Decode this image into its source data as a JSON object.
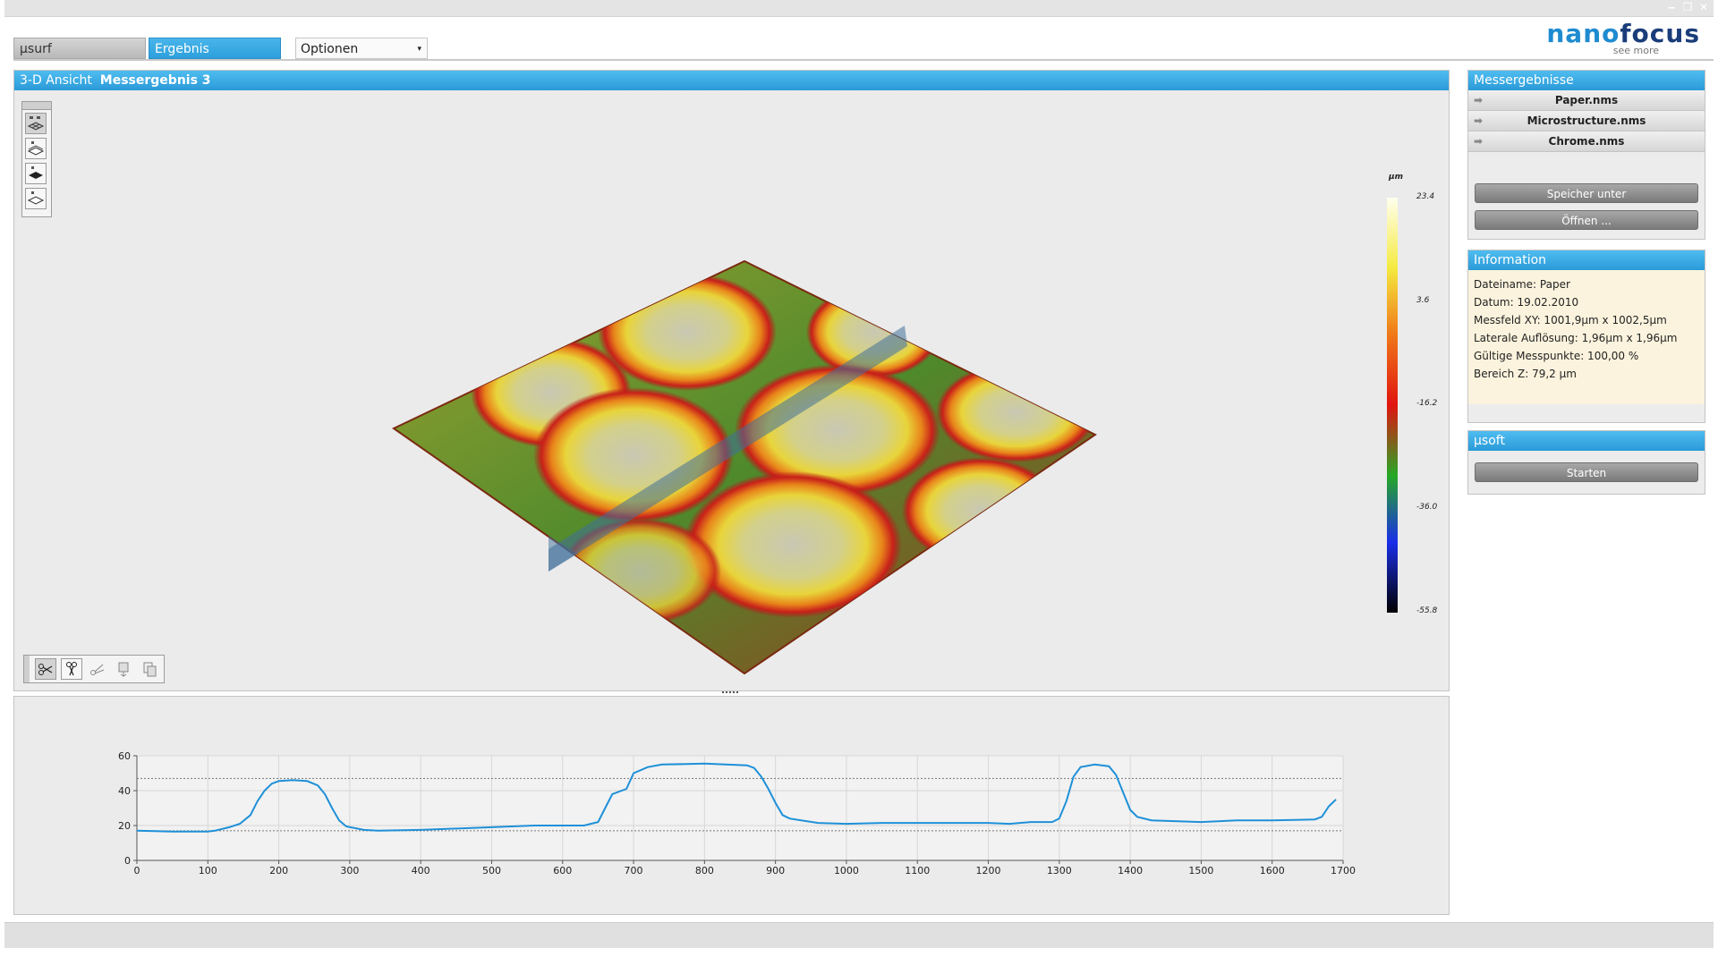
{
  "window": {
    "minimize_glyph": "‒",
    "restore_glyph": "❐",
    "close_glyph": "✕"
  },
  "tabs": [
    {
      "label": "µsurf"
    },
    {
      "label": "Ergebnis"
    }
  ],
  "options_dropdown": {
    "label": "Optionen",
    "arrow": "▾"
  },
  "logo": {
    "brand_part1": "nano",
    "brand_part2": "focus",
    "tagline": "see more"
  },
  "view3d": {
    "header_label": "3-D Ansicht",
    "header_title": "Messergebnis 3",
    "view_mode_icons": [
      "surface-mesh-icon",
      "surface-wireframe-icon",
      "surface-filled-icon",
      "surface-outline-icon"
    ],
    "tool_icons": [
      "cut-tool-icon",
      "cut-profile-icon",
      "cut-angle-icon",
      "export-icon",
      "copy-icon"
    ],
    "colorbar": {
      "unit": "µm",
      "ticks": [
        "23.4",
        "3.6",
        "-16.2",
        "-36.0",
        "-55.8"
      ],
      "colors": [
        "#ffffee",
        "#f5ea40",
        "#f07818",
        "#e01410",
        "#26a826",
        "#1a2ee8",
        "#000000"
      ]
    }
  },
  "chart_data": {
    "type": "line",
    "title": "",
    "xlabel": "",
    "ylabel": "",
    "xlim": [
      0,
      1700
    ],
    "ylim": [
      0,
      60
    ],
    "x_ticks": [
      "0",
      "100",
      "200",
      "300",
      "400",
      "500",
      "600",
      "700",
      "800",
      "900",
      "1000",
      "1100",
      "1200",
      "1300",
      "1400",
      "1500",
      "1600",
      "1700"
    ],
    "y_ticks": [
      "0",
      "20",
      "40",
      "60"
    ],
    "grid": true,
    "reference_lines": [
      47,
      17
    ],
    "line_color": "#1e90d8",
    "series": [
      {
        "x": [
          0,
          50,
          100,
          110,
          130,
          145,
          160,
          170,
          180,
          190,
          200,
          220,
          240,
          255,
          265,
          275,
          285,
          295,
          320,
          340,
          400,
          500,
          560,
          630,
          650,
          660,
          670,
          690,
          700,
          720,
          740,
          800,
          830,
          860,
          870,
          880,
          890,
          900,
          910,
          920,
          960,
          1000,
          1050,
          1100,
          1200,
          1230,
          1260,
          1290,
          1300,
          1310,
          1320,
          1330,
          1350,
          1370,
          1380,
          1390,
          1400,
          1410,
          1430,
          1500,
          1550,
          1600,
          1660,
          1670,
          1680,
          1690
        ],
        "y": [
          17,
          16.5,
          16.5,
          17,
          19,
          21,
          26,
          34,
          40,
          44,
          45.5,
          46,
          45.5,
          43,
          38,
          30,
          23,
          19.5,
          17.5,
          17,
          17.5,
          19,
          20,
          20,
          22,
          30,
          38,
          41,
          50,
          53.5,
          55,
          55.5,
          55,
          54.5,
          53,
          48,
          41,
          33,
          26,
          24,
          21.5,
          21,
          21.5,
          21.5,
          21.5,
          21,
          22,
          22,
          24,
          34,
          48,
          53.5,
          55,
          54,
          49,
          39,
          29,
          25,
          23,
          22,
          23,
          23,
          23.5,
          25,
          31,
          35
        ]
      }
    ]
  },
  "right_panel": {
    "results_header": "Messergebnisse",
    "files": [
      "Paper.nms",
      "Microstructure.nms",
      "Chrome.nms"
    ],
    "file_arrow": "➡",
    "save_button": "Speicher unter",
    "open_button": "Öffnen ...",
    "info_header": "Information",
    "info_lines": [
      "Dateiname: Paper",
      "Datum: 19.02.2010",
      "Messfeld XY: 1001,9µm x 1002,5µm",
      "Laterale Auflösung: 1,96µm x 1,96µm",
      "Gültige Messpunkte: 100,00 %",
      "Bereich Z: 79,2 µm"
    ],
    "usoft_header": "µsoft",
    "start_button": "Starten"
  }
}
